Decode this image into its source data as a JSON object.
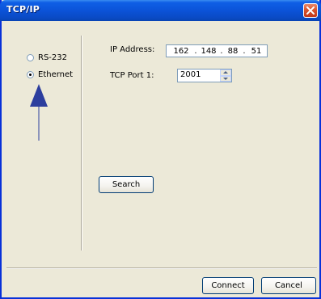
{
  "window": {
    "title": "TCP/IP"
  },
  "connection_type": {
    "options": [
      {
        "label": "RS-232",
        "selected": false
      },
      {
        "label": "Ethernet",
        "selected": true
      }
    ]
  },
  "fields": {
    "ip_label": "IP Address:",
    "ip_octets": [
      "162",
      "148",
      "88",
      "51"
    ],
    "ip_separator": ".",
    "port_label": "TCP Port 1:",
    "port_value": "2001"
  },
  "buttons": {
    "search": "Search",
    "connect": "Connect",
    "cancel": "Cancel"
  },
  "colors": {
    "title_bar": "#0b53d8",
    "dialog_face": "#ece9d8",
    "arrow": "#2c3e9e"
  }
}
